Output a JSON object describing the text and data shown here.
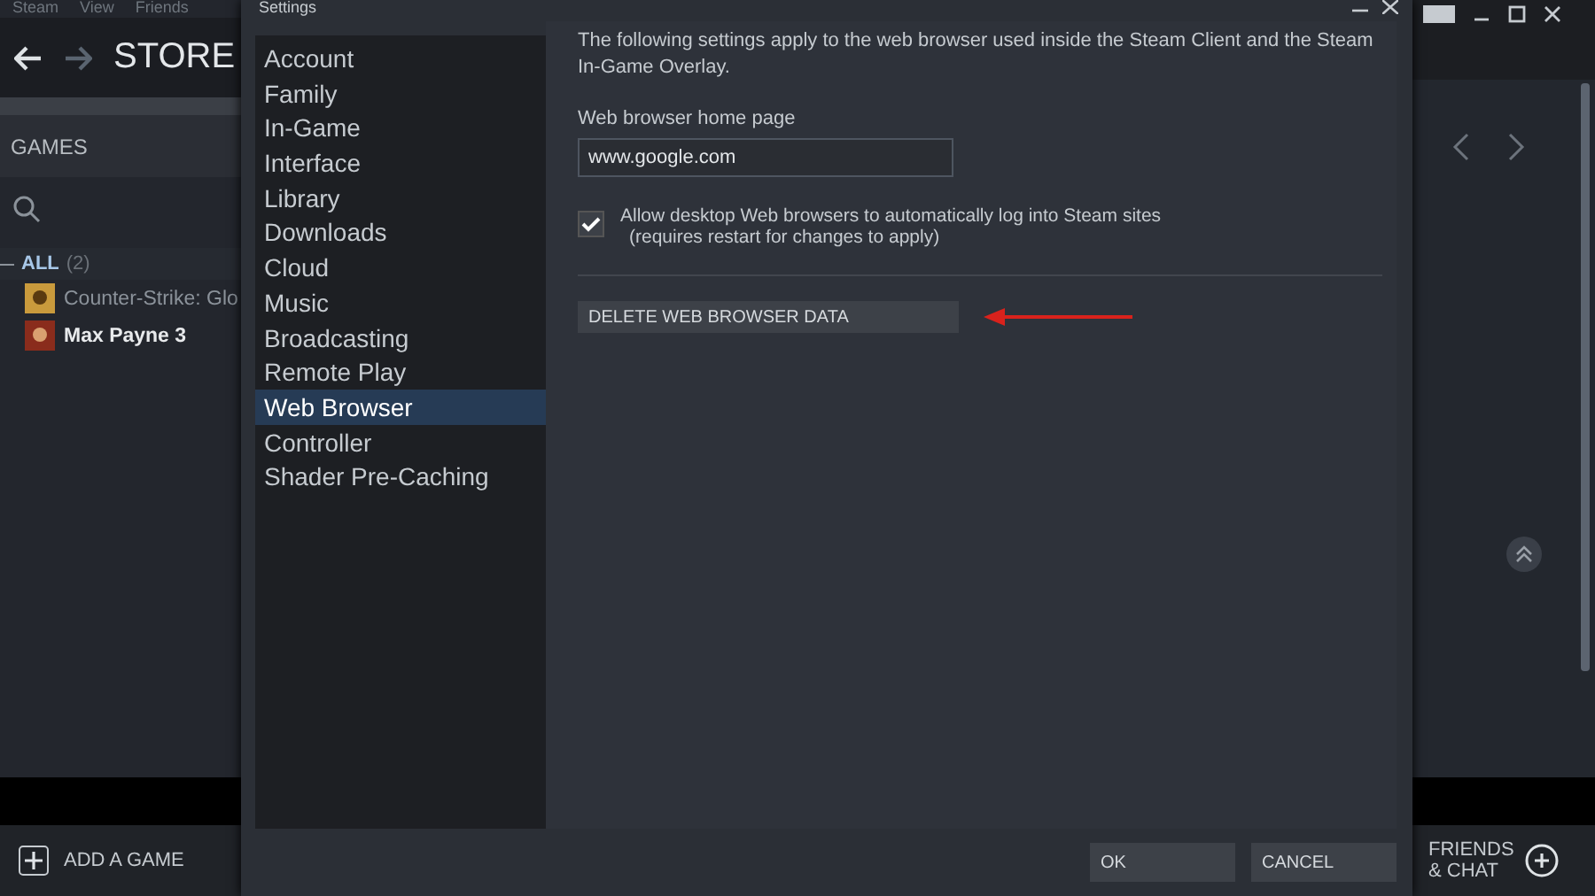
{
  "menu": [
    "Steam",
    "View",
    "Friends"
  ],
  "nav": {
    "title": "STORE"
  },
  "library": {
    "header": "GAMES",
    "filter": {
      "label": "ALL",
      "count": "(2)"
    },
    "games": [
      {
        "name": "Counter-Strike: Glo",
        "installed": false
      },
      {
        "name": "Max Payne 3",
        "installed": true
      }
    ]
  },
  "add_game": "ADD A GAME",
  "friends": [
    "FRIENDS",
    "& CHAT"
  ],
  "dialog": {
    "title": "Settings",
    "sidebar": [
      {
        "label": "Account",
        "selected": false
      },
      {
        "label": "Family",
        "selected": false
      },
      {
        "label": "In-Game",
        "selected": false
      },
      {
        "label": "Interface",
        "selected": false
      },
      {
        "label": "Library",
        "selected": false
      },
      {
        "label": "Downloads",
        "selected": false
      },
      {
        "label": "Cloud",
        "selected": false
      },
      {
        "label": "Music",
        "selected": false
      },
      {
        "label": "Broadcasting",
        "selected": false
      },
      {
        "label": "Remote Play",
        "selected": false
      },
      {
        "label": "Web Browser",
        "selected": true
      },
      {
        "label": "Controller",
        "selected": false
      },
      {
        "label": "Shader Pre-Caching",
        "selected": false
      }
    ],
    "description": "The following settings apply to the web browser used inside the Steam Client and the Steam In-Game Overlay.",
    "home_page": {
      "label": "Web browser home page",
      "value": "www.google.com"
    },
    "auto_login": {
      "label": "Allow desktop Web browsers to automatically log into Steam sites",
      "note": "(requires restart for changes to apply)",
      "checked": true
    },
    "delete_button": "DELETE WEB BROWSER DATA",
    "buttons": [
      "OK",
      "CANCEL"
    ]
  }
}
